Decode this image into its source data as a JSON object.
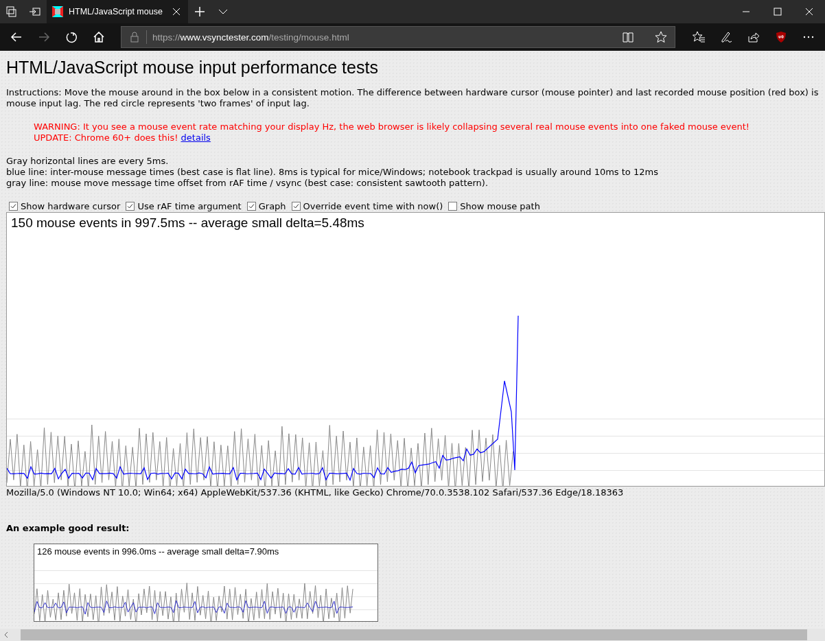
{
  "browser": {
    "tabs": [
      {
        "title": "HTML/JavaScript mouse",
        "selected": true
      }
    ],
    "address": {
      "scheme": "https://",
      "domain": "www.vsynctester.com",
      "path": "/testing/mouse.html"
    },
    "nav": {
      "back_disabled": false,
      "forward_disabled": true
    }
  },
  "page": {
    "heading": "HTML/JavaScript mouse input performance tests",
    "instructions": "Instructions: Move the mouse around in the box below in a consistent motion. The difference between hardware cursor (mouse pointer) and last recorded mouse position (red box) is mouse input lag. The red circle represents 'two frames' of input lag.",
    "warning": "WARNING: It you see a mouse event rate matching your display Hz, the web browser is likely collapsing several real mouse events into one faked mouse event!",
    "update": "UPDATE: Chrome 60+ does this! ",
    "update_link": "details",
    "notes": [
      "Gray horizontal lines are every 5ms.",
      "blue line: inter-mouse message times (best case is flat line). 8ms is typical for mice/Windows; notebook trackpad is usually around 10ms to 12ms",
      "gray line: mouse move message time offset from rAF time / vsync (best case: consistent sawtooth pattern)."
    ],
    "options": [
      {
        "label": "Show hardware cursor",
        "checked": true
      },
      {
        "label": "Use rAF time argument",
        "checked": true
      },
      {
        "label": "Graph",
        "checked": true
      },
      {
        "label": "Override event time with now()",
        "checked": true
      },
      {
        "label": "Show mouse path",
        "checked": false
      }
    ],
    "graph_title": "150 mouse events in 997.5ms -- average small delta=5.48ms",
    "user_agent": "Mozilla/5.0 (Windows NT 10.0; Win64; x64) AppleWebKit/537.36 (KHTML, like Gecko) Chrome/70.0.3538.102 Safari/537.36 Edge/18.18363",
    "example_heading": "An example good result:",
    "example_title": "126 mouse events in 996.0ms -- average small delta=7.90ms"
  }
}
